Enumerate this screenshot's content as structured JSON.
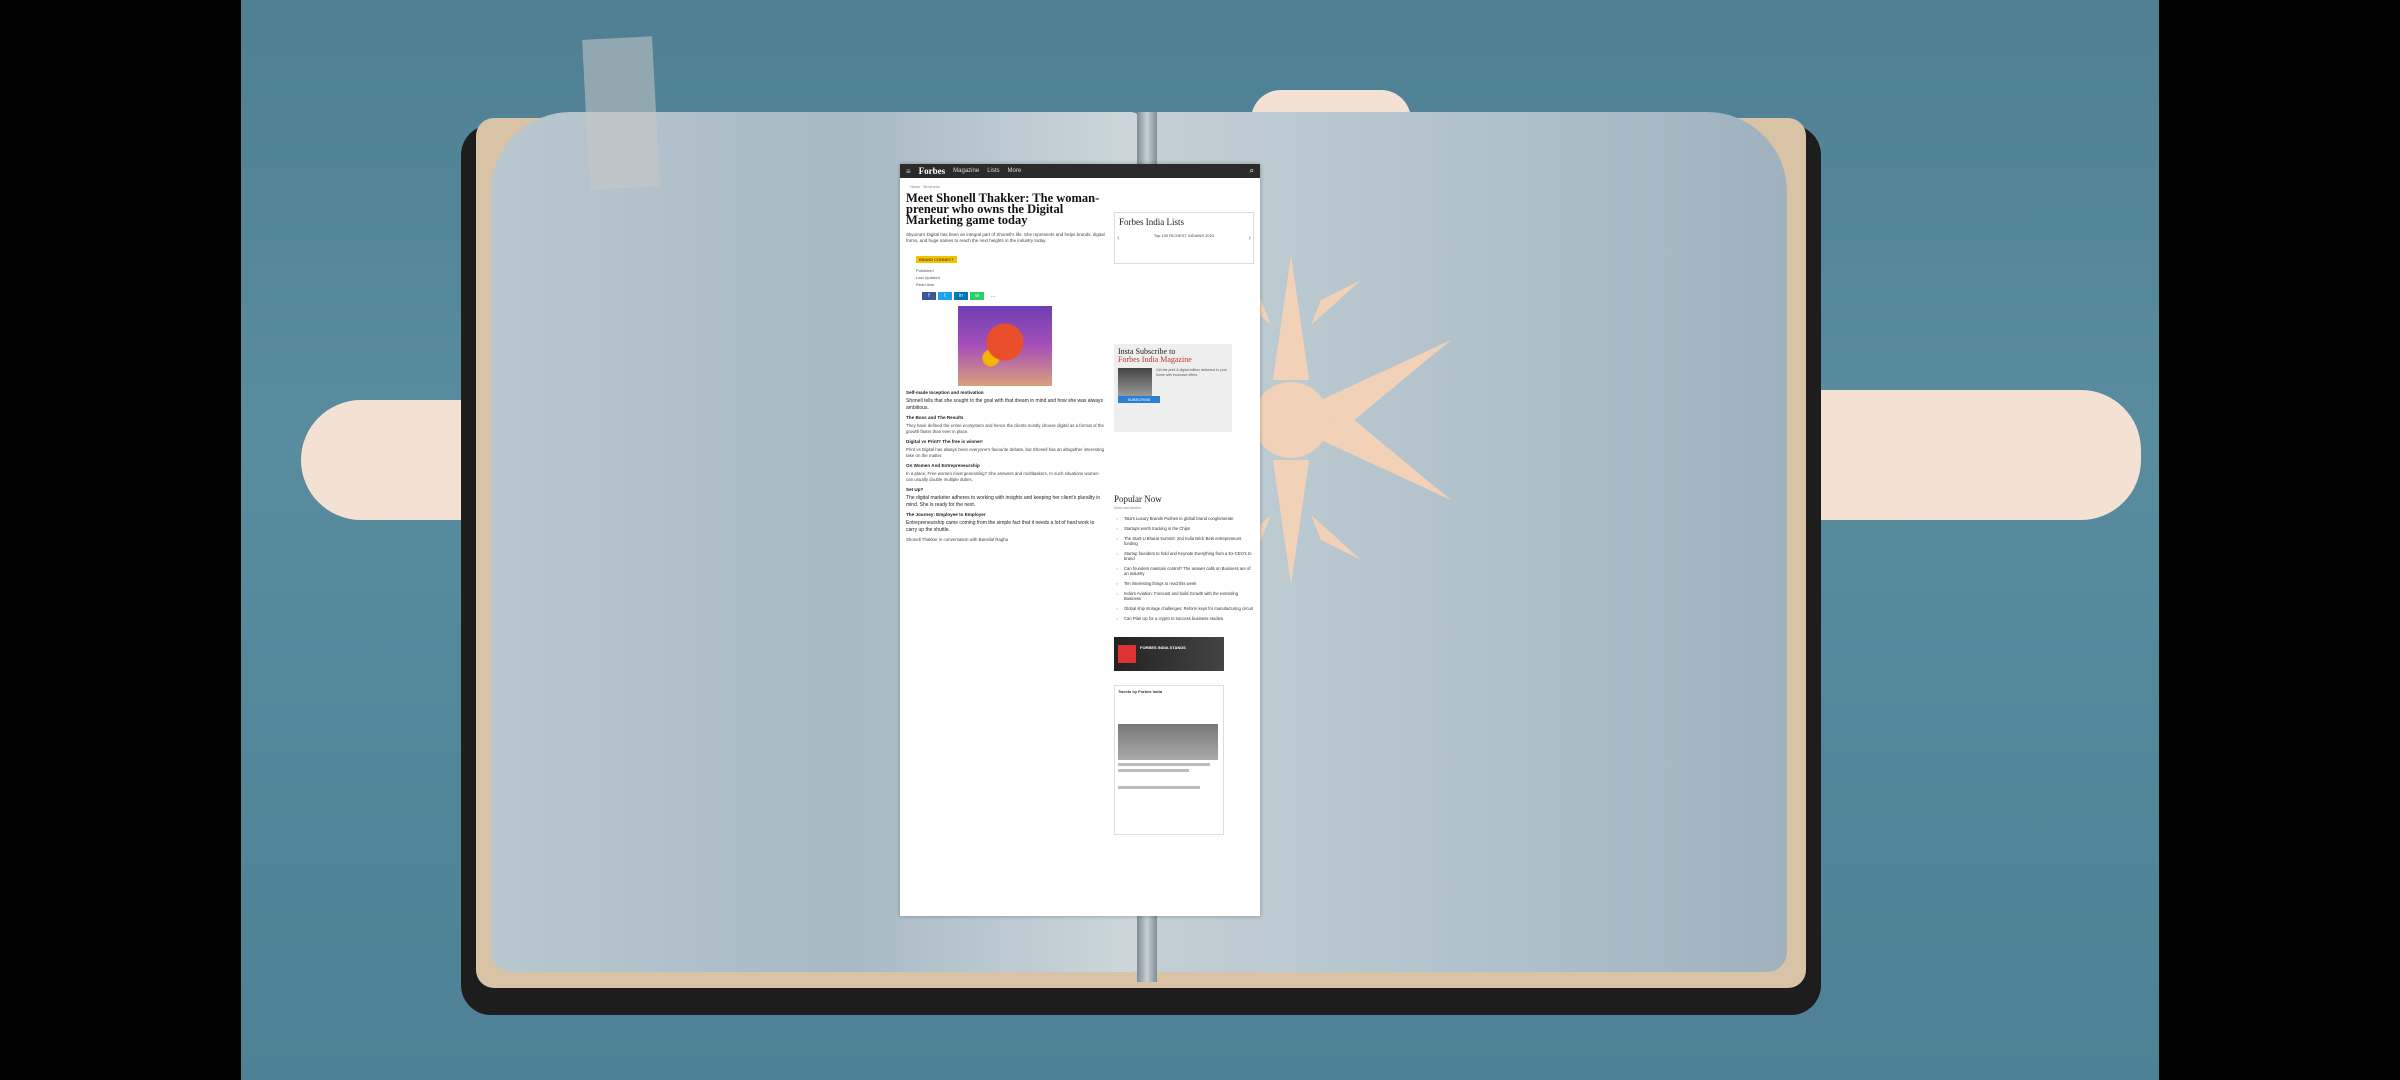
{
  "nav": {
    "logo": "Forbes",
    "menu": "≡",
    "links": [
      "Magazine",
      "Lists",
      "More"
    ],
    "search": "⌕"
  },
  "article": {
    "breadcrumb": "News · Business",
    "title": "Meet Shonell Thakker: The woman-preneur who owns the Digital Marketing game today",
    "subtitle": "Skyuma's Digital has been an integral part of Shonell's life. She represents and helps brands, digital forms, and huge names to reach the next heights in the industry today.",
    "tag": "BRAND CONNECT",
    "byline": [
      "Published",
      "Last Updated",
      "Read time"
    ],
    "paragraphs": [
      {
        "kind": "h",
        "text": "Self-made Inception and motivation"
      },
      {
        "kind": "p",
        "text": "Shonell tells that she sought to the goal with that dream in mind and how she was always ambitious."
      },
      {
        "kind": "h",
        "text": "The Boss and The Results"
      },
      {
        "kind": "p",
        "text": "They have defined the entire ecosystem and hence the clients mostly choose digital as a format of the growth faster than ever in place."
      },
      {
        "kind": "h",
        "text": "Digital vs Print? The free is winner!"
      },
      {
        "kind": "p",
        "text": "Print vs Digital has always been everyone's favourite debate, but Shonell has an altogether interesting take on the matter."
      },
      {
        "kind": "h",
        "text": "On Women And Entrepreneurship"
      },
      {
        "kind": "p",
        "text": "In a place, Free women must generating? She answers and multitaskers. In such situations women can usually double multiple duties."
      },
      {
        "kind": "h",
        "text": "Set Up?"
      },
      {
        "kind": "p",
        "text": "The digital marketer adheres to working with insights and keeping her client's plurality in mind. She is ready for the next."
      },
      {
        "kind": "h",
        "text": "The Journey: Employee to Employer"
      },
      {
        "kind": "p",
        "text": "Entrepreneurship came coming from the simple fact that it needs a lot of hard work to carry up the shuttle."
      },
      {
        "kind": "p",
        "text": "Shonell Thakker in conversation with Bansilal Raghu"
      }
    ]
  },
  "sidebar": {
    "lists_title": "Forbes India Lists",
    "lists_item": "Top 100 RICHEST INDIANS 2023",
    "subscribe_title_a": "Insta Subscribe to",
    "subscribe_title_b": "Forbes India Magazine",
    "subscribe_text": "Get the print & digital edition delivered to your home with exclusive offers.",
    "subscribe_button": "SUBSCRIBE",
    "popular_title": "Popular Now",
    "popular_sub": "Most read stories",
    "popular_items": [
      "Tata's Luxury Brands Pushes to global brand conglomerate",
      "Startups worth tracking in the Chips",
      "The Start-U Bharat Summit: 2nd India Brick Bets entrepreneurs funding",
      "Startup founders to hold and Keynote Everything from a Ex-CEO's to brand",
      "Can founders maintain control? The answer calls on Business are of an industry",
      "Ten interesting things to read this week",
      "India's Aviation: Forecast and build Growth with the extending Business",
      "Global ship storage challenges: Reform keys for manufacturing circuit",
      "Can Plan Up for a crypto to success business studies"
    ],
    "ad_text": "FORBES INDIA STANDS",
    "tweet_head": "Tweets by Forbes India"
  }
}
